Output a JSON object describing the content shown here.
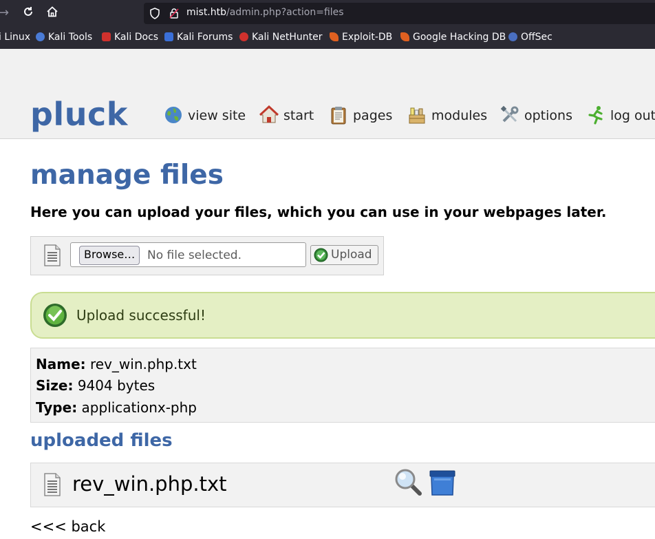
{
  "browser": {
    "url_host": "mist.htb",
    "url_path": "/admin.php?action=files",
    "bookmarks": [
      {
        "label": "i Linux",
        "color": ""
      },
      {
        "label": "Kali Tools",
        "color": "#4a7bd6"
      },
      {
        "label": "Kali Docs",
        "color": "#d0312d"
      },
      {
        "label": "Kali Forums",
        "color": "#3a6fd8"
      },
      {
        "label": "Kali NetHunter",
        "color": "#d0312d"
      },
      {
        "label": "Exploit-DB",
        "color": "#e06020"
      },
      {
        "label": "Google Hacking DB",
        "color": "#e06020"
      },
      {
        "label": "OffSec",
        "color": "#4a6fc0"
      }
    ]
  },
  "header": {
    "logo": "pluck",
    "menu": {
      "view_site": "view site",
      "start": "start",
      "pages": "pages",
      "modules": "modules",
      "options": "options",
      "log_out": "log out"
    }
  },
  "main": {
    "title": "manage files",
    "intro": "Here you can upload your files, which you can use in your webpages later.",
    "upload": {
      "browse_label": "Browse…",
      "no_file": "No file selected.",
      "upload_label": "Upload"
    },
    "success_message": "Upload successful!",
    "info": {
      "name_label": "Name:",
      "name_value": "rev_win.php.txt",
      "size_label": "Size:",
      "size_value": "9404 bytes",
      "type_label": "Type:",
      "type_value": "applicationx-php"
    },
    "uploaded_title": "uploaded files",
    "files": [
      {
        "name": "rev_win.php.txt"
      }
    ],
    "back_label": "<<< back"
  },
  "colors": {
    "accent": "#3e67a6",
    "success_bg": "#e4efc4",
    "chrome_bg": "#2b2a33"
  }
}
